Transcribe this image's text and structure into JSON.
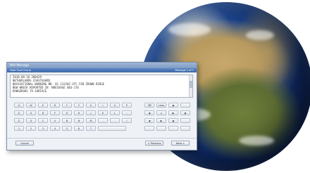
{
  "window": {
    "title": "NAV Message",
    "subtitle": "Date Time Group",
    "subtitle_right": "Message 1 of 1"
  },
  "message": {
    "lines": [
      "2010-08-18 200429",
      "",
      "NETHERLANDS COASTGUARD",
      "NAVIGATIONAL WARNING NR. 81 131502 UTC FEB ZROWN RIDGE",
      "NEW WRECK REPORTED IN 'WRECKAGE 003-17E",
      "DANGEROUS TO SURFACE"
    ]
  },
  "keypad": {
    "row1": [
      "Q",
      "W",
      "E",
      "R",
      "T",
      "Y",
      "U",
      "I",
      "O",
      "P"
    ],
    "row2": [
      "A",
      "S",
      "D",
      "F",
      "G",
      "H",
      "J",
      "K",
      "L",
      ";"
    ],
    "row3": [
      "Z",
      "X",
      "C",
      "V",
      "B",
      "N",
      "M",
      ",",
      ".",
      "/"
    ],
    "row4": [
      "1",
      "2",
      "3",
      "4",
      "5",
      "6",
      "7"
    ],
    "right_keys": [
      "⌫",
      "clear",
      "◆",
      "◀",
      "⌂",
      "▶",
      "◆",
      "◀",
      "▶",
      "◆"
    ]
  },
  "footer": {
    "cancel": "Cancel",
    "previous": "< Previous",
    "next": "Next >"
  },
  "colors": {
    "titlebar": "#7f9bc3",
    "subtitlebar": "#3c67a8",
    "window_bg": "#eef1f5"
  }
}
